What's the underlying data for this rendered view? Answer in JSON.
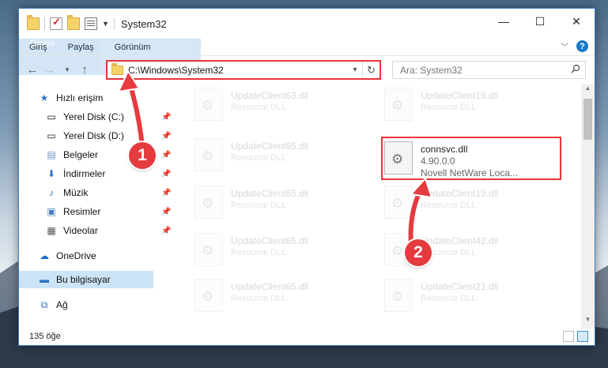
{
  "window": {
    "title": "System32"
  },
  "ribbon": {
    "tabs": [
      "Dosya",
      "Giriş",
      "Paylaş",
      "Görünüm"
    ]
  },
  "address": {
    "path": "C:\\Windows\\System32"
  },
  "search": {
    "placeholder": "Ara: System32"
  },
  "sidebar": {
    "items": [
      {
        "label": "Hızlı erişim",
        "icon": "star-icon"
      },
      {
        "label": "Yerel Disk (C:)",
        "icon": "drive-icon",
        "pinned": true
      },
      {
        "label": "Yerel Disk (D:)",
        "icon": "drive-icon",
        "pinned": true
      },
      {
        "label": "Belgeler",
        "icon": "documents-icon",
        "pinned": true
      },
      {
        "label": "İndirmeler",
        "icon": "download-icon",
        "pinned": true
      },
      {
        "label": "Müzik",
        "icon": "music-icon",
        "pinned": true
      },
      {
        "label": "Resimler",
        "icon": "pictures-icon",
        "pinned": true
      },
      {
        "label": "Videolar",
        "icon": "videos-icon",
        "pinned": true
      },
      {
        "label": "OneDrive",
        "icon": "cloud-icon"
      },
      {
        "label": "Bu bilgisayar",
        "icon": "computer-icon",
        "selected": true
      },
      {
        "label": "Ağ",
        "icon": "network-icon"
      }
    ]
  },
  "files": {
    "left": [
      {
        "name": "UpdateClient63.dll",
        "desc": "Resource DLL"
      },
      {
        "name": "UpdateClient65.dll",
        "desc": "Resource DLL"
      },
      {
        "name": "UpdateClient65.dll",
        "desc": "Resource DLL"
      },
      {
        "name": "UpdateClient65.dll",
        "desc": "Resource DLL"
      },
      {
        "name": "UpdateClient65.dll",
        "desc": "Resource DLL"
      }
    ],
    "right": [
      {
        "name": "UpdateClient19.dll",
        "desc": "Resource DLL"
      },
      {
        "name": "connsvc.dll",
        "version": "4.90.0.0",
        "desc": "Novell NetWare Loca..."
      },
      {
        "name": "UpdateClient19.dll",
        "desc": "Resource DLL"
      },
      {
        "name": "UpdateClient42.dll",
        "desc": "Resource DLL"
      },
      {
        "name": "UpdateClient21.dll",
        "desc": "Resource DLL"
      }
    ]
  },
  "status": {
    "count": "135 öğe"
  },
  "markers": [
    "1",
    "2"
  ],
  "colors": {
    "accent": "#1979ca",
    "highlight": "#e8343a",
    "selection": "#cce4f7"
  }
}
